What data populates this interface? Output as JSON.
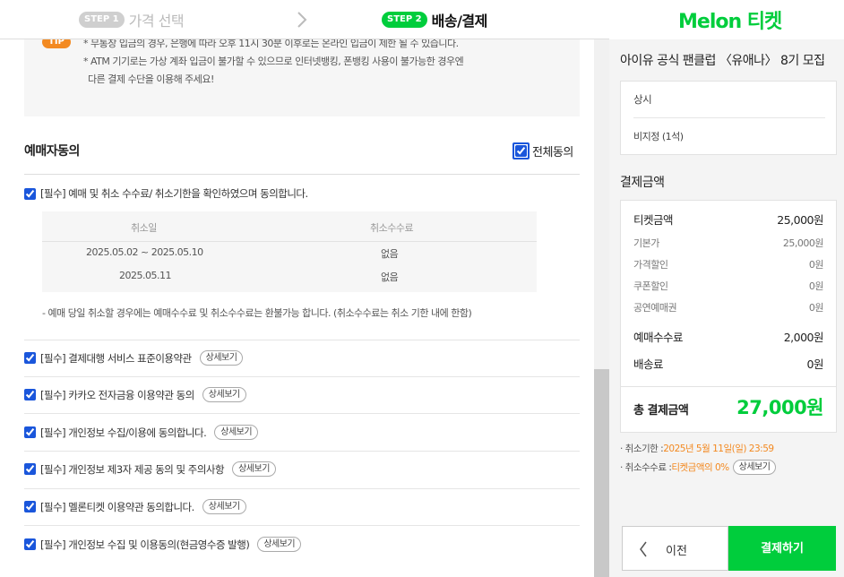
{
  "steps": {
    "step1": {
      "badge": "STEP 1",
      "label": "가격 선택"
    },
    "step2": {
      "badge": "STEP 2",
      "label": "배송/결제"
    }
  },
  "logo": {
    "text": "Melon 티켓"
  },
  "tip": {
    "badge": "TIP",
    "lines": [
      "* 무통장 입금의 경우, 은행에 따라 오후 11시 30분 이후로는 온라인 입금이 제한 될 수 있습니다.",
      "* ATM 기기로는 가상 계좌 입금이 불가할 수 있으므로 인터넷뱅킹, 폰뱅킹 사용이 불가능한 경우엔",
      "다른 결제 수단을 이용해 주세요!"
    ]
  },
  "agreement": {
    "title": "예매자동의",
    "all_agree_label": "전체동의",
    "first_item": "[필수] 예매 및 취소 수수료/ 취소기한을 확인하였으며 동의합니다.",
    "cancel_table": {
      "headers": [
        "취소일",
        "취소수수료"
      ],
      "rows": [
        [
          "2025.05.02 ~ 2025.05.10",
          "없음"
        ],
        [
          "2025.05.11",
          "없음"
        ]
      ]
    },
    "note": "- 예매 당일 취소할 경우에는 예매수수료 및 취소수수료는 환불가능 합니다. (취소수수료는 취소 기한 내에 한함)",
    "detail_label": "상세보기",
    "items": [
      "[필수] 결제대행 서비스 표준이용약관",
      "[필수] 카카오 전자금융 이용약관 동의",
      "[필수] 개인정보 수집/이용에 동의합니다.",
      "[필수] 개인정보 제3자 제공 동의 및 주의사항",
      "[필수] 멜론티켓 이용약관 동의합니다.",
      "[필수] 개인정보 수집 및 이용동의(현금영수증 발행)"
    ]
  },
  "summary": {
    "event_title": "아이유 공식 팬클럽 〈유애나〉 8기 모집",
    "seat_line1": "상시",
    "seat_line2": "비지정 (1석)",
    "pay_title": "결제금액",
    "ticket_amount": {
      "label": "티켓금액",
      "value": "25,000원"
    },
    "base_price": {
      "label": "기본가",
      "value": "25,000원"
    },
    "price_discount": {
      "label": "가격할인",
      "value": "0원"
    },
    "coupon_discount": {
      "label": "쿠폰할인",
      "value": "0원"
    },
    "show_voucher": {
      "label": "공연예매권",
      "value": "0원"
    },
    "booking_fee": {
      "label": "예매수수료",
      "value": "2,000원"
    },
    "delivery_fee": {
      "label": "배송료",
      "value": "0원"
    },
    "total": {
      "label": "총 결제금액",
      "value": "27,000원"
    },
    "cancel_deadline": {
      "label": "· 취소기한 : ",
      "value": "2025년 5월 11일(일) 23:59"
    },
    "cancel_fee": {
      "label": "· 취소수수료 : ",
      "value": "티켓금액의 0%"
    }
  },
  "buttons": {
    "prev": "이전",
    "pay": "결제하기"
  },
  "colors": {
    "brand_green": "#00cd3c",
    "accent_orange": "#f38a22",
    "checkbox_blue": "#1a56db"
  }
}
